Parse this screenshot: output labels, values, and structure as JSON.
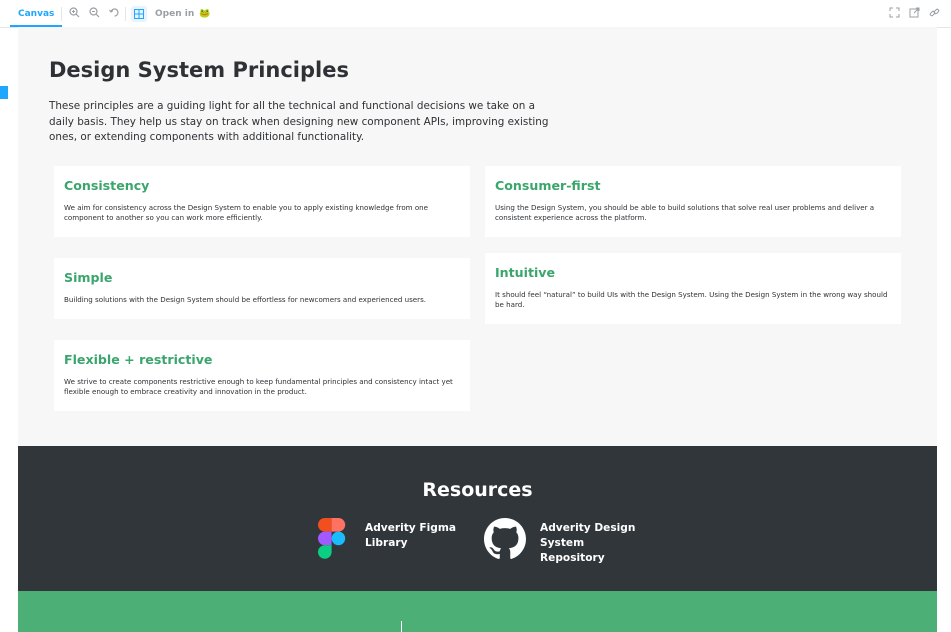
{
  "toolbar": {
    "tab_label": "Canvas",
    "open_in_label": "Open in",
    "open_in_icon": "frog-icon"
  },
  "page": {
    "title": "Design System Principles",
    "intro": "These principles are a guiding light for all the technical and functional decisions we take on a daily basis. They help us stay on track when designing new component APIs, improving existing ones, or extending components with additional functionality."
  },
  "principles": [
    {
      "title": "Consistency",
      "text": "We aim for consistency across the Design System to enable you to apply existing knowledge from one component to another so you can work more efficiently."
    },
    {
      "title": "Consumer-first",
      "text": "Using the Design System, you should be able to build solutions that solve real user problems and deliver a consistent experience across the platform."
    },
    {
      "title": "Simple",
      "text": "Building solutions with the Design System should be effortless for newcomers and experienced users."
    },
    {
      "title": "Intuitive",
      "text": "It should feel “natural” to build UIs with the Design System. Using the Design System in the wrong way should be hard."
    },
    {
      "title": "Flexible + restrictive",
      "text": "We strive to create components restrictive enough to keep fundamental principles and consistency intact yet flexible enough to embrace creativity and innovation in the product."
    }
  ],
  "resources": {
    "title": "Resources",
    "links": [
      {
        "label": "Adverity Figma Library",
        "icon": "figma-icon"
      },
      {
        "label": "Adverity Design System Repository",
        "icon": "github-icon"
      }
    ]
  },
  "colors": {
    "accent_green": "#3aa56c",
    "dark_band": "#31363b",
    "footer_green": "#4caf76",
    "storybook_blue": "#1ea7fd"
  }
}
